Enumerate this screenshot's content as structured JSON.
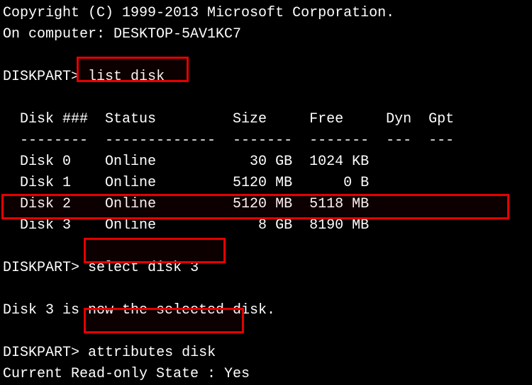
{
  "header": {
    "copyright": "Copyright (C) 1999-2013 Microsoft Corporation.",
    "computer_line": "On computer: DESKTOP-5AV1KC7"
  },
  "prompt": "DISKPART>",
  "commands": {
    "list_disk": "list disk",
    "select_disk": "select disk 3",
    "attributes_disk": "attributes disk"
  },
  "table": {
    "header": "  Disk ###  Status         Size     Free     Dyn  Gpt",
    "separator": "  --------  -------------  -------  -------  ---  ---",
    "rows": [
      "  Disk 0    Online           30 GB  1024 KB",
      "  Disk 1    Online         5120 MB      0 B",
      "  Disk 2    Online         5120 MB  5118 MB",
      "  Disk 3    Online            8 GB  8190 MB"
    ]
  },
  "messages": {
    "selected": "Disk 3 is now the selected disk."
  },
  "attributes_output": {
    "readonly_state": "Current Read-only State : Yes"
  }
}
